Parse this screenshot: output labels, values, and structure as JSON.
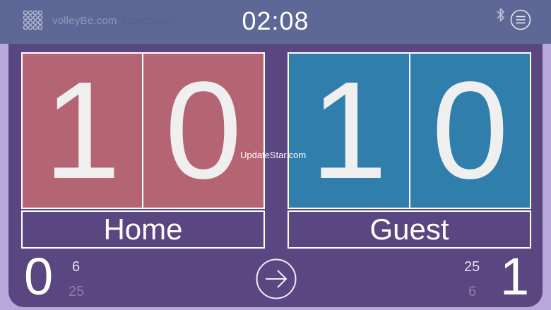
{
  "header": {
    "brand": "volleyBe.com",
    "brand_sub": "Scoreboard",
    "clock": "02:08"
  },
  "home": {
    "score_tens": "1",
    "score_units": "0",
    "label": "Home",
    "sets": "0",
    "set_scores": [
      "6",
      "25"
    ]
  },
  "guest": {
    "score_tens": "1",
    "score_units": "0",
    "label": "Guest",
    "sets": "1",
    "set_scores": [
      "25",
      "6"
    ]
  },
  "watermark": "UpdateStar.com",
  "icons": {
    "grid": "grid-icon",
    "bluetooth": "bluetooth-icon",
    "menu": "menu-icon",
    "next": "arrow-right-circle-icon"
  },
  "colors": {
    "home": "#b56474",
    "guest": "#2f7eab",
    "panel": "#5a4680",
    "topbar": "#5e6896",
    "border": "#b8a8d9"
  }
}
